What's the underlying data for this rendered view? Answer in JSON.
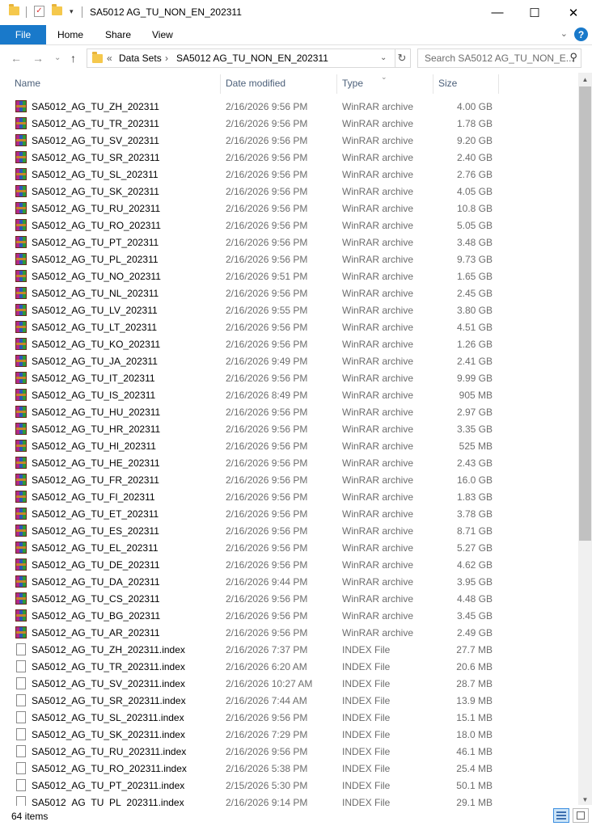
{
  "window": {
    "title": "SA5012 AG_TU_NON_EN_202311",
    "controls": {
      "minimize": "—",
      "maximize": "☐",
      "close": "✕"
    }
  },
  "ribbon": {
    "tabs": [
      "File",
      "Home",
      "Share",
      "View"
    ],
    "help": "?"
  },
  "address": {
    "overflow": "«",
    "crumbs": [
      "Data Sets",
      "SA5012 AG_TU_NON_EN_202311"
    ],
    "search_placeholder": "Search SA5012 AG_TU_NON_E..."
  },
  "columns": {
    "name": "Name",
    "date": "Date modified",
    "type": "Type",
    "size": "Size"
  },
  "files": [
    {
      "name": "SA5012_AG_TU_ZH_202311",
      "date": "2/16/2026 9:56 PM",
      "type": "WinRAR archive",
      "size": "4.00 GB",
      "icon": "rar"
    },
    {
      "name": "SA5012_AG_TU_TR_202311",
      "date": "2/16/2026 9:56 PM",
      "type": "WinRAR archive",
      "size": "1.78 GB",
      "icon": "rar"
    },
    {
      "name": "SA5012_AG_TU_SV_202311",
      "date": "2/16/2026 9:56 PM",
      "type": "WinRAR archive",
      "size": "9.20 GB",
      "icon": "rar"
    },
    {
      "name": "SA5012_AG_TU_SR_202311",
      "date": "2/16/2026 9:56 PM",
      "type": "WinRAR archive",
      "size": "2.40 GB",
      "icon": "rar"
    },
    {
      "name": "SA5012_AG_TU_SL_202311",
      "date": "2/16/2026 9:56 PM",
      "type": "WinRAR archive",
      "size": "2.76 GB",
      "icon": "rar"
    },
    {
      "name": "SA5012_AG_TU_SK_202311",
      "date": "2/16/2026 9:56 PM",
      "type": "WinRAR archive",
      "size": "4.05 GB",
      "icon": "rar"
    },
    {
      "name": "SA5012_AG_TU_RU_202311",
      "date": "2/16/2026 9:56 PM",
      "type": "WinRAR archive",
      "size": "10.8 GB",
      "icon": "rar"
    },
    {
      "name": "SA5012_AG_TU_RO_202311",
      "date": "2/16/2026 9:56 PM",
      "type": "WinRAR archive",
      "size": "5.05 GB",
      "icon": "rar"
    },
    {
      "name": "SA5012_AG_TU_PT_202311",
      "date": "2/16/2026 9:56 PM",
      "type": "WinRAR archive",
      "size": "3.48 GB",
      "icon": "rar"
    },
    {
      "name": "SA5012_AG_TU_PL_202311",
      "date": "2/16/2026 9:56 PM",
      "type": "WinRAR archive",
      "size": "9.73 GB",
      "icon": "rar"
    },
    {
      "name": "SA5012_AG_TU_NO_202311",
      "date": "2/16/2026 9:51 PM",
      "type": "WinRAR archive",
      "size": "1.65 GB",
      "icon": "rar"
    },
    {
      "name": "SA5012_AG_TU_NL_202311",
      "date": "2/16/2026 9:56 PM",
      "type": "WinRAR archive",
      "size": "2.45 GB",
      "icon": "rar"
    },
    {
      "name": "SA5012_AG_TU_LV_202311",
      "date": "2/16/2026 9:55 PM",
      "type": "WinRAR archive",
      "size": "3.80 GB",
      "icon": "rar"
    },
    {
      "name": "SA5012_AG_TU_LT_202311",
      "date": "2/16/2026 9:56 PM",
      "type": "WinRAR archive",
      "size": "4.51 GB",
      "icon": "rar"
    },
    {
      "name": "SA5012_AG_TU_KO_202311",
      "date": "2/16/2026 9:56 PM",
      "type": "WinRAR archive",
      "size": "1.26 GB",
      "icon": "rar"
    },
    {
      "name": "SA5012_AG_TU_JA_202311",
      "date": "2/16/2026 9:49 PM",
      "type": "WinRAR archive",
      "size": "2.41 GB",
      "icon": "rar"
    },
    {
      "name": "SA5012_AG_TU_IT_202311",
      "date": "2/16/2026 9:56 PM",
      "type": "WinRAR archive",
      "size": "9.99 GB",
      "icon": "rar"
    },
    {
      "name": "SA5012_AG_TU_IS_202311",
      "date": "2/16/2026 8:49 PM",
      "type": "WinRAR archive",
      "size": "905 MB",
      "icon": "rar"
    },
    {
      "name": "SA5012_AG_TU_HU_202311",
      "date": "2/16/2026 9:56 PM",
      "type": "WinRAR archive",
      "size": "2.97 GB",
      "icon": "rar"
    },
    {
      "name": "SA5012_AG_TU_HR_202311",
      "date": "2/16/2026 9:56 PM",
      "type": "WinRAR archive",
      "size": "3.35 GB",
      "icon": "rar"
    },
    {
      "name": "SA5012_AG_TU_HI_202311",
      "date": "2/16/2026 9:56 PM",
      "type": "WinRAR archive",
      "size": "525 MB",
      "icon": "rar"
    },
    {
      "name": "SA5012_AG_TU_HE_202311",
      "date": "2/16/2026 9:56 PM",
      "type": "WinRAR archive",
      "size": "2.43 GB",
      "icon": "rar"
    },
    {
      "name": "SA5012_AG_TU_FR_202311",
      "date": "2/16/2026 9:56 PM",
      "type": "WinRAR archive",
      "size": "16.0 GB",
      "icon": "rar"
    },
    {
      "name": "SA5012_AG_TU_FI_202311",
      "date": "2/16/2026 9:56 PM",
      "type": "WinRAR archive",
      "size": "1.83 GB",
      "icon": "rar"
    },
    {
      "name": "SA5012_AG_TU_ET_202311",
      "date": "2/16/2026 9:56 PM",
      "type": "WinRAR archive",
      "size": "3.78 GB",
      "icon": "rar"
    },
    {
      "name": "SA5012_AG_TU_ES_202311",
      "date": "2/16/2026 9:56 PM",
      "type": "WinRAR archive",
      "size": "8.71 GB",
      "icon": "rar"
    },
    {
      "name": "SA5012_AG_TU_EL_202311",
      "date": "2/16/2026 9:56 PM",
      "type": "WinRAR archive",
      "size": "5.27 GB",
      "icon": "rar"
    },
    {
      "name": "SA5012_AG_TU_DE_202311",
      "date": "2/16/2026 9:56 PM",
      "type": "WinRAR archive",
      "size": "4.62 GB",
      "icon": "rar"
    },
    {
      "name": "SA5012_AG_TU_DA_202311",
      "date": "2/16/2026 9:44 PM",
      "type": "WinRAR archive",
      "size": "3.95 GB",
      "icon": "rar"
    },
    {
      "name": "SA5012_AG_TU_CS_202311",
      "date": "2/16/2026 9:56 PM",
      "type": "WinRAR archive",
      "size": "4.48 GB",
      "icon": "rar"
    },
    {
      "name": "SA5012_AG_TU_BG_202311",
      "date": "2/16/2026 9:56 PM",
      "type": "WinRAR archive",
      "size": "3.45 GB",
      "icon": "rar"
    },
    {
      "name": "SA5012_AG_TU_AR_202311",
      "date": "2/16/2026 9:56 PM",
      "type": "WinRAR archive",
      "size": "2.49 GB",
      "icon": "rar"
    },
    {
      "name": "SA5012_AG_TU_ZH_202311.index",
      "date": "2/16/2026 7:37 PM",
      "type": "INDEX File",
      "size": "27.7 MB",
      "icon": "file"
    },
    {
      "name": "SA5012_AG_TU_TR_202311.index",
      "date": "2/16/2026 6:20 AM",
      "type": "INDEX File",
      "size": "20.6 MB",
      "icon": "file"
    },
    {
      "name": "SA5012_AG_TU_SV_202311.index",
      "date": "2/16/2026 10:27 AM",
      "type": "INDEX File",
      "size": "28.7 MB",
      "icon": "file"
    },
    {
      "name": "SA5012_AG_TU_SR_202311.index",
      "date": "2/16/2026 7:44 AM",
      "type": "INDEX File",
      "size": "13.9 MB",
      "icon": "file"
    },
    {
      "name": "SA5012_AG_TU_SL_202311.index",
      "date": "2/16/2026 9:56 PM",
      "type": "INDEX File",
      "size": "15.1 MB",
      "icon": "file"
    },
    {
      "name": "SA5012_AG_TU_SK_202311.index",
      "date": "2/16/2026 7:29 PM",
      "type": "INDEX File",
      "size": "18.0 MB",
      "icon": "file"
    },
    {
      "name": "SA5012_AG_TU_RU_202311.index",
      "date": "2/16/2026 9:56 PM",
      "type": "INDEX File",
      "size": "46.1 MB",
      "icon": "file"
    },
    {
      "name": "SA5012_AG_TU_RO_202311.index",
      "date": "2/16/2026 5:38 PM",
      "type": "INDEX File",
      "size": "25.4 MB",
      "icon": "file"
    },
    {
      "name": "SA5012_AG_TU_PT_202311.index",
      "date": "2/15/2026 5:30 PM",
      "type": "INDEX File",
      "size": "50.1 MB",
      "icon": "file"
    },
    {
      "name": "SA5012_AG_TU_PL_202311.index",
      "date": "2/16/2026 9:14 PM",
      "type": "INDEX File",
      "size": "29.1 MB",
      "icon": "file"
    }
  ],
  "status": {
    "count": "64 items"
  },
  "colors": {
    "accent": "#1979ca",
    "header_text": "#4c607a",
    "secondary_text": "#6d6d6d"
  }
}
